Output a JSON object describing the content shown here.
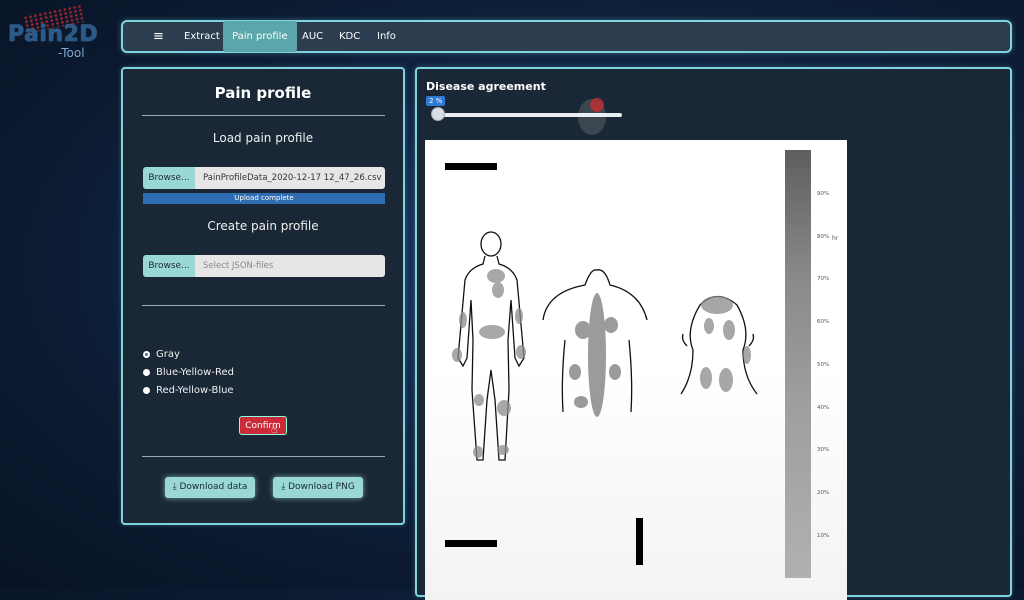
{
  "logo": {
    "title": "Pain2D",
    "subtitle": "-Tool"
  },
  "nav": {
    "menu_icon": "≡",
    "items": [
      "Extract",
      "Pain profile",
      "AUC",
      "KDC",
      "Info"
    ],
    "active": "Pain profile"
  },
  "left": {
    "title": "Pain profile",
    "load_label": "Load pain profile",
    "browse_label": "Browse...",
    "loaded_file": "PainProfileData_2020-12-17 12_47_26.csv",
    "upload_status": "Upload complete",
    "create_label": "Create pain profile",
    "json_placeholder": "Select JSON-files",
    "color_options": [
      "Gray",
      "Blue-Yellow-Red",
      "Red-Yellow-Blue"
    ],
    "selected_color": "Gray",
    "confirm_label": "Confirm",
    "download_data_label": "Download data",
    "download_png_label": "Download PNG"
  },
  "right": {
    "title": "Disease agreement",
    "slider_value": "2 %",
    "slider_fraction": 0.02,
    "colorbar_ticks": [
      "90%",
      "80%",
      "70%",
      "60%",
      "50%",
      "40%",
      "30%",
      "20%",
      "10%"
    ],
    "colorbar_unit": "hr"
  },
  "colors": {
    "accent": "#7fd3dd",
    "active_tab": "#5aa6aa",
    "button": "#9ad8d8",
    "confirm": "#cc2a36",
    "progress": "#2f6db3"
  }
}
